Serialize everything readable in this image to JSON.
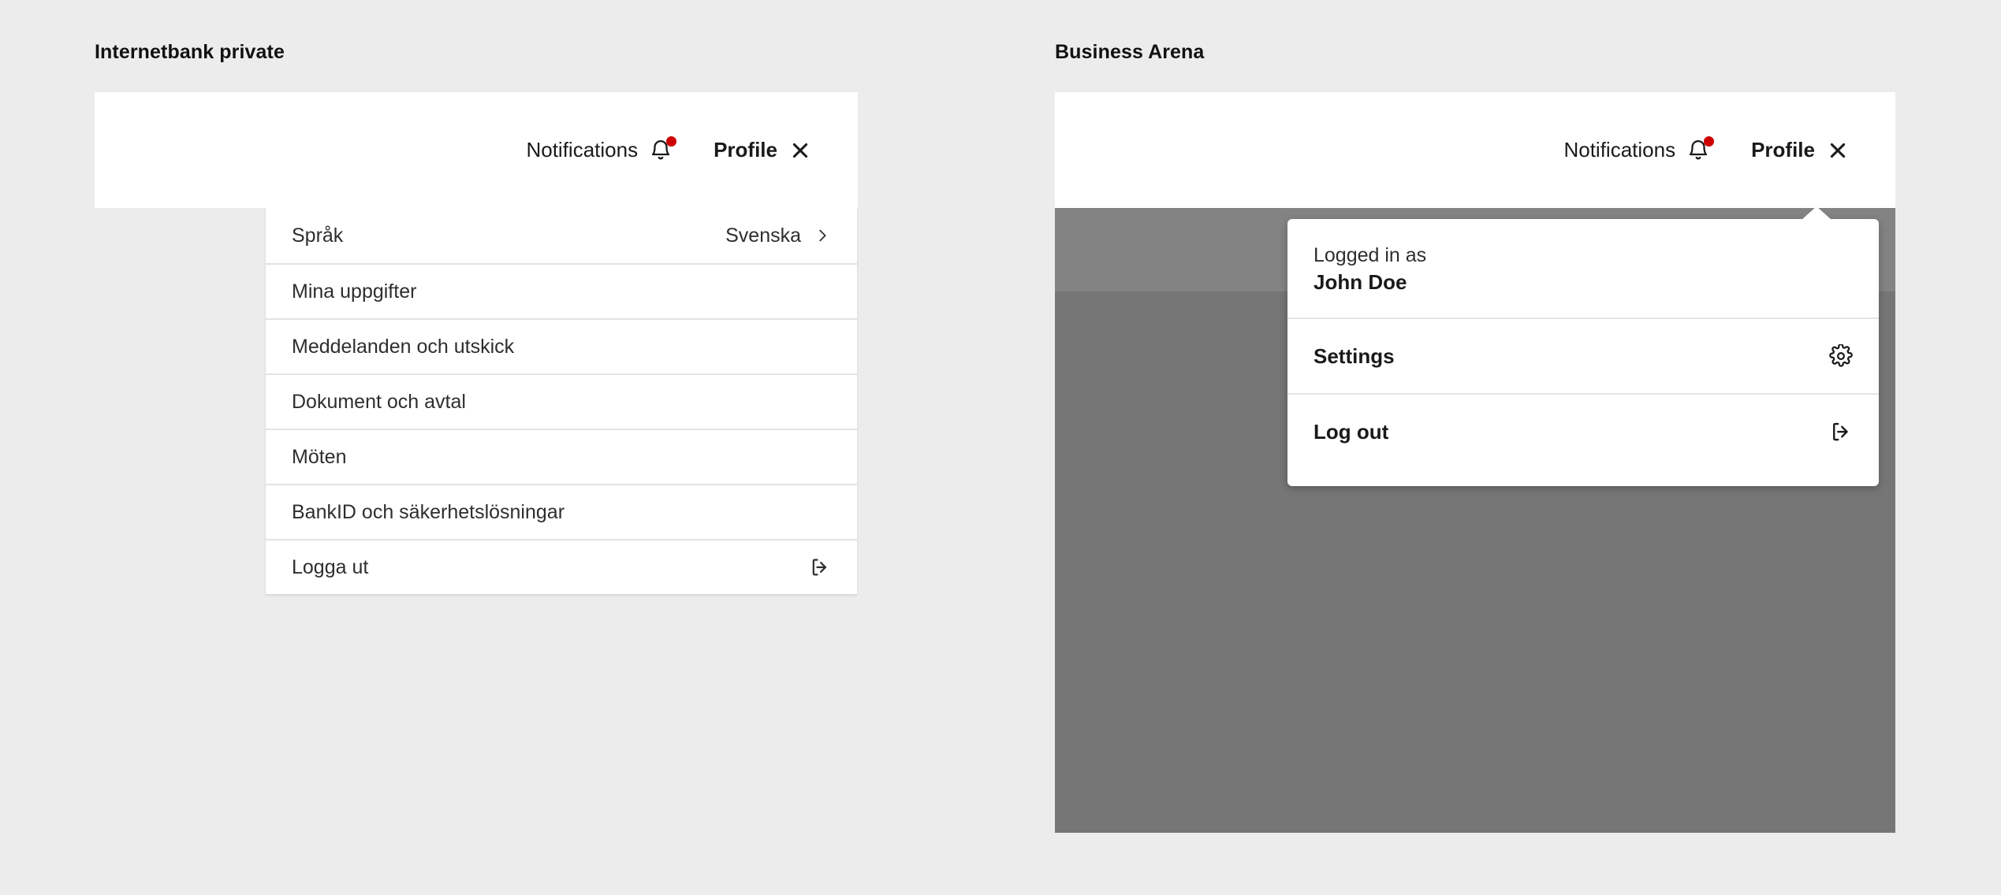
{
  "left_panel": {
    "title": "Internetbank private",
    "header": {
      "notifications_label": "Notifications",
      "notifications_icon": "bell-icon",
      "badge_color": "#cc0000",
      "profile_label": "Profile",
      "profile_icon": "close-icon"
    },
    "menu_items": [
      {
        "label": "Språk",
        "value": "Svenska",
        "icon": "chevron-right-icon"
      },
      {
        "label": "Mina uppgifter",
        "value": "",
        "icon": ""
      },
      {
        "label": "Meddelanden och utskick",
        "value": "",
        "icon": ""
      },
      {
        "label": "Dokument och avtal",
        "value": "",
        "icon": ""
      },
      {
        "label": "Möten",
        "value": "",
        "icon": ""
      },
      {
        "label": "BankID och säkerhetslösningar",
        "value": "",
        "icon": ""
      },
      {
        "label": "Logga ut",
        "value": "",
        "icon": "logout-icon"
      }
    ]
  },
  "right_panel": {
    "title": "Business Arena",
    "header": {
      "notifications_label": "Notifications",
      "notifications_icon": "bell-icon",
      "badge_color": "#cc0000",
      "profile_label": "Profile",
      "profile_icon": "close-icon"
    },
    "popover": {
      "caption": "Logged in as",
      "user_name": "John Doe",
      "items": [
        {
          "label": "Settings",
          "icon": "gear-icon"
        },
        {
          "label": "Log out",
          "icon": "logout-icon"
        }
      ]
    }
  }
}
